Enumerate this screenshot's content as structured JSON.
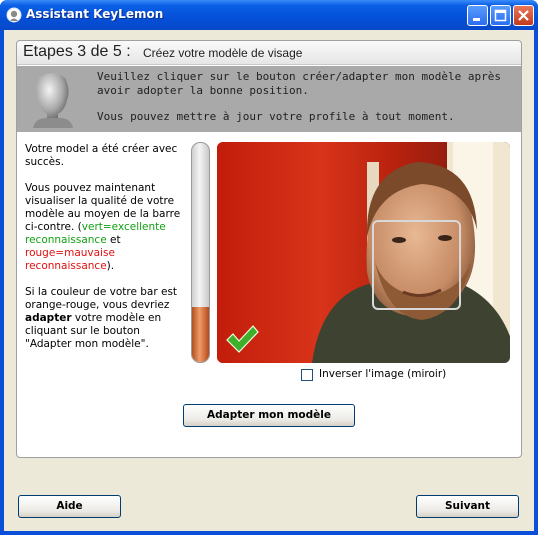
{
  "window": {
    "title": "Assistant KeyLemon",
    "icons": {
      "app": "keylemon-icon",
      "minimize": "minimize-icon",
      "maximize": "maximize-icon",
      "close": "close-icon"
    }
  },
  "step": {
    "title": "Etapes 3 de 5 :",
    "subtitle": "Créez votre modèle de visage"
  },
  "banner": {
    "line1": "Veuillez cliquer sur le bouton créer/adapter mon modèle après avoir adopter la bonne position.",
    "line2": "Vous pouvez mettre à jour votre profile à tout moment.",
    "icon": "head-model-icon"
  },
  "instructions": {
    "p1": "Votre model a été créer avec succès.",
    "p2_before": "Vous pouvez maintenant visualiser la qualité de votre modèle au moyen de la barre ci-contre. (",
    "p2_green": "vert=excellente reconnaissance",
    "p2_mid": " et ",
    "p2_red": "rouge=mauvaise reconnaissance",
    "p2_after": ").",
    "p3_before": "Si la couleur de votre bar est orange-rouge, vous devriez ",
    "p3_bold": "adapter",
    "p3_after": " votre modèle en cliquant sur le bouton \"Adapter mon modèle\"."
  },
  "quality": {
    "level": 0.25,
    "color": "orange-red"
  },
  "camera": {
    "icon": "checkmark-icon"
  },
  "mirror": {
    "label": "Inverser l'image (miroir)",
    "checked": false
  },
  "buttons": {
    "adapt": "Adapter mon modèle",
    "help": "Aide",
    "next": "Suivant"
  },
  "colors": {
    "titlebar": "#0550d8",
    "good": "#12a012",
    "bad": "#e01010",
    "background": "#ece9d8"
  }
}
